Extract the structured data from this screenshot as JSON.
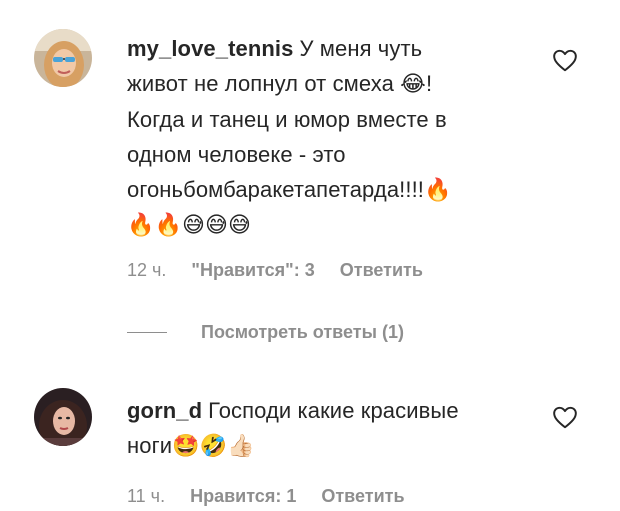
{
  "comments": [
    {
      "username": "my_love_tennis",
      "text_line1": "У меня чуть",
      "line2_text": "живот не лопнул от смеха",
      "line2_emoji": "😂",
      "line2_end": "!",
      "line3": "Когда и танец и юмор вместе в",
      "line4": "одном человеке - это",
      "line5_text": "огоньбомбаракетапетарда!!!!",
      "line5_emoji": "🔥",
      "line6_emoji": "🔥🔥😅😅😅",
      "time": "12 ч.",
      "likes": "\"Нравится\": 3",
      "reply_label": "Ответить",
      "view_replies": "Посмотреть ответы (1)",
      "avatar_icon": "user-avatar-icon"
    },
    {
      "username": "gorn_d",
      "text_line1": "Господи какие красивые",
      "line2_text": "ноги",
      "line2_emoji": "🤩🤣👍🏻",
      "time": "11 ч.",
      "likes": "Нравится: 1",
      "reply_label": "Ответить",
      "avatar_icon": "user-avatar-icon"
    }
  ],
  "colors": {
    "text": "#262626",
    "secondary": "#8e8e8e"
  }
}
